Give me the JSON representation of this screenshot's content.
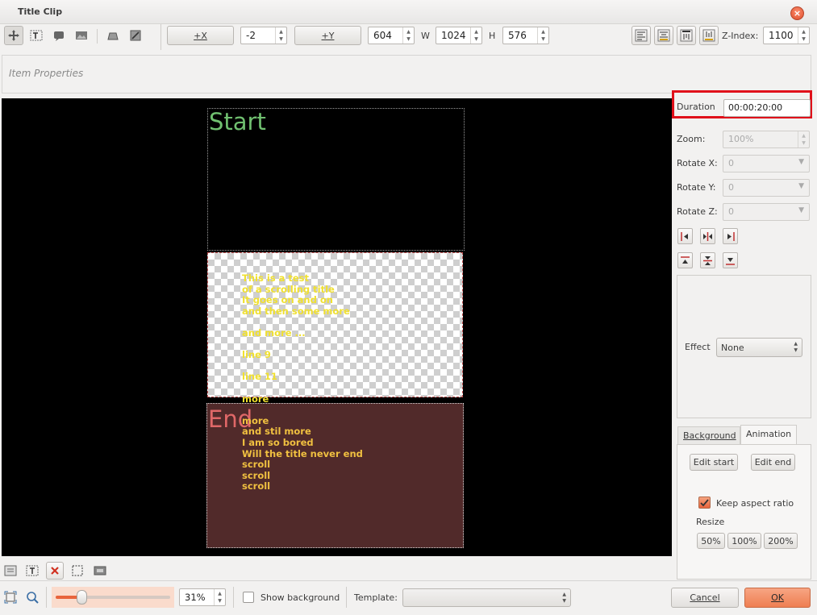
{
  "window": {
    "title": "Title Clip"
  },
  "toolbar": {
    "tool_icons": [
      "select-tool-icon",
      "text-tool-icon",
      "rect-tool-icon",
      "image-tool-icon",
      "raise-icon",
      "lower-icon"
    ],
    "plus_x_label": "+X",
    "x_value": "-2",
    "plus_y_label": "+Y",
    "y_value": "604",
    "w_label": "W",
    "w_value": "1024",
    "h_label": "H",
    "h_value": "576",
    "zindex_label": "Z-Index:",
    "zindex_value": "1100"
  },
  "item_properties": {
    "label": "Item Properties"
  },
  "canvas": {
    "start_label": "Start",
    "end_label": "End",
    "scroll_lines": [
      "This is a test",
      "of a scrolling title",
      "It goes on and on",
      "and then some more",
      "",
      "and more ...",
      "",
      "line 9",
      "",
      "line 11",
      "",
      "more",
      "",
      "more",
      "and stil more",
      "I am so bored",
      "Will the title never end",
      "scroll",
      "scroll",
      "scroll"
    ]
  },
  "right_panel": {
    "duration_label": "Duration",
    "duration_value": "00:00:20:00",
    "zoom_label": "Zoom:",
    "zoom_value": "100%",
    "rotate_x_label": "Rotate X:",
    "rotate_x_value": "0",
    "rotate_y_label": "Rotate Y:",
    "rotate_y_value": "0",
    "rotate_z_label": "Rotate Z:",
    "rotate_z_value": "0",
    "effect_label": "Effect",
    "effect_value": "None",
    "tabs": {
      "background": "Background",
      "animation": "Animation"
    },
    "edit_start_label": "Edit start",
    "edit_end_label": "Edit end",
    "keep_aspect_label": "Keep aspect ratio",
    "resize_label": "Resize",
    "resize_50": "50%",
    "resize_100": "100%",
    "resize_200": "200%"
  },
  "bottom": {
    "zoom_value": "31%",
    "show_background_label": "Show background",
    "template_label": "Template:",
    "template_value": "",
    "cancel_label": "Cancel",
    "ok_label": "OK"
  },
  "colors": {
    "highlight_box": "#e0101a",
    "ok_button": "#f08a5d",
    "accent": "#e8643c"
  }
}
